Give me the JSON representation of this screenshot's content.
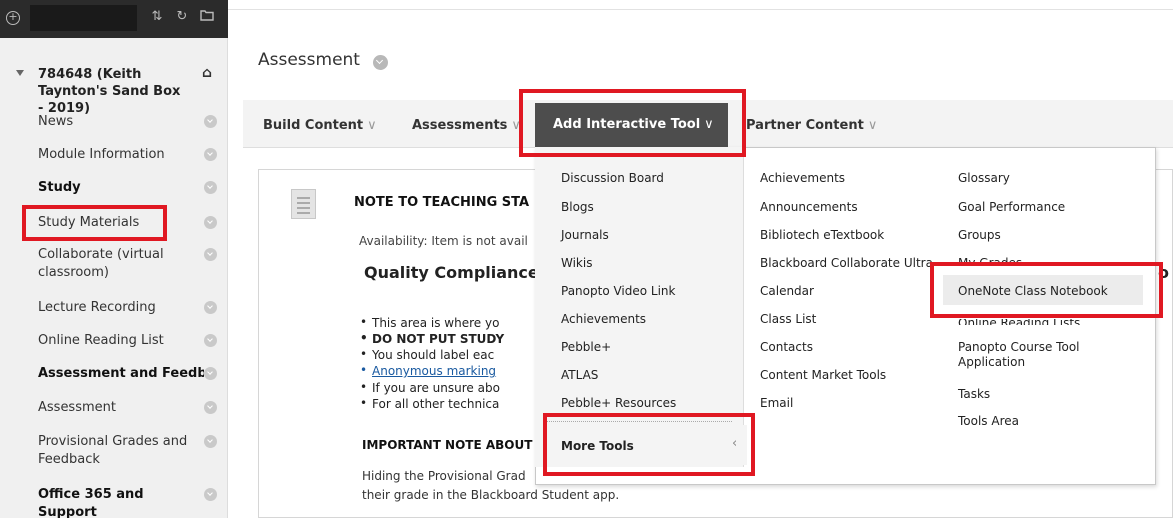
{
  "sidebar": {
    "course_title": "784648 (Keith Taynton's Sand Box - 2019)",
    "items": [
      {
        "label": "News",
        "bold": false
      },
      {
        "label": "Module Information",
        "bold": false
      },
      {
        "label": "Study",
        "bold": true
      },
      {
        "label": "Study Materials",
        "bold": false
      },
      {
        "label": "Collaborate (virtual classroom)",
        "bold": false
      },
      {
        "label": "Lecture Recording",
        "bold": false
      },
      {
        "label": "Online Reading List",
        "bold": false
      },
      {
        "label": "Assessment and Feedbac",
        "bold": true
      },
      {
        "label": "Assessment",
        "bold": false
      },
      {
        "label": "Provisional Grades and Feedback",
        "bold": false
      },
      {
        "label": "Office 365 and Support",
        "bold": true
      }
    ],
    "icons": [
      "add-icon",
      "sort-icon",
      "refresh-icon",
      "folder-icon",
      "home-icon"
    ]
  },
  "page": {
    "title": "Assessment"
  },
  "toolbar": {
    "build_content": "Build Content",
    "assessments": "Assessments",
    "add_interactive_tool": "Add Interactive Tool",
    "partner_content": "Partner Content"
  },
  "content": {
    "title": "NOTE TO TEACHING STA",
    "availability": "Availability:  Item is not avail",
    "heading": "Quality Compliance",
    "bullets": [
      "This area is where yo",
      "DO NOT PUT STUDY",
      "You should label eac",
      "Anonymous marking",
      "If you are unsure abo",
      "For all other technica"
    ],
    "important": "IMPORTANT NOTE ABOUT",
    "hiding_line1": "Hiding the Provisional Grad",
    "hiding_line2": "their grade in the Blackboard Student app.",
    "right_fragment": "o"
  },
  "dropdown": {
    "col1": [
      "Discussion Board",
      "Blogs",
      "Journals",
      "Wikis",
      "Panopto Video Link",
      "Achievements",
      "Pebble+",
      "ATLAS",
      "Pebble+ Resources"
    ],
    "col2": [
      "Achievements",
      "Announcements",
      "Bibliotech eTextbook",
      "Blackboard Collaborate Ultra",
      "Calendar",
      "Class List",
      "Contacts",
      "Content Market Tools",
      "Email"
    ],
    "col3": [
      "Glossary",
      "Goal Performance",
      "Groups",
      "My Grades",
      "OneNote Class Notebook",
      "Online Reading Lists",
      "Panopto Course Tool Application",
      "Tasks",
      "Tools Area"
    ],
    "more_tools": "More Tools"
  },
  "colors": {
    "highlight_box": "#e01822",
    "active_tab_bg": "#4d4d4d",
    "sidebar_bg": "#f0f0f0",
    "topbar_bg": "#2b2b2b",
    "link": "#1a5aa0"
  }
}
